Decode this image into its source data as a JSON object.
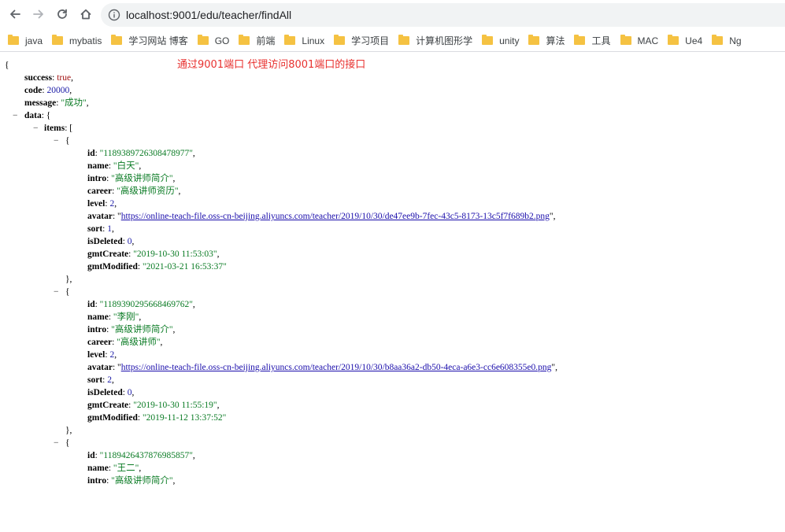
{
  "browser": {
    "url": "localhost:9001/edu/teacher/findAll",
    "bookmarks": [
      "java",
      "mybatis",
      "学习网站 博客",
      "GO",
      "前端",
      "Linux",
      "学习项目",
      "计算机图形学",
      "unity",
      "算法",
      "工具",
      "MAC",
      "Ue4",
      "Ng"
    ]
  },
  "annotation": "通过9001端口 代理访问8001端口的接口",
  "json": {
    "open_brace": "{",
    "success_key": "success",
    "success_val": "true",
    "code_key": "code",
    "code_val": "20000",
    "message_key": "message",
    "message_val": "\"成功\"",
    "data_key": "data",
    "items_key": "items",
    "collapse_sign": "−",
    "entries": [
      {
        "id": "\"1189389726308478977\"",
        "name": "\"白天\"",
        "intro": "\"高级讲师简介\"",
        "career": "\"高级讲师资历\"",
        "level": "2",
        "avatar": "https://online-teach-file.oss-cn-beijing.aliyuncs.com/teacher/2019/10/30/de47ee9b-7fec-43c5-8173-13c5f7f689b2.png",
        "sort": "1",
        "isDeleted": "0",
        "gmtCreate": "\"2019-10-30 11:53:03\"",
        "gmtModified": "\"2021-03-21 16:53:37\""
      },
      {
        "id": "\"1189390295668469762\"",
        "name": "\"李刚\"",
        "intro": "\"高级讲师简介\"",
        "career": "\"高级讲师\"",
        "level": "2",
        "avatar": "https://online-teach-file.oss-cn-beijing.aliyuncs.com/teacher/2019/10/30/b8aa36a2-db50-4eca-a6e3-cc6e608355e0.png",
        "sort": "2",
        "isDeleted": "0",
        "gmtCreate": "\"2019-10-30 11:55:19\"",
        "gmtModified": "\"2019-11-12 13:37:52\""
      },
      {
        "id": "\"1189426437876985857\"",
        "name": "\"王二\"",
        "intro": "\"高级讲师简介\""
      }
    ]
  }
}
